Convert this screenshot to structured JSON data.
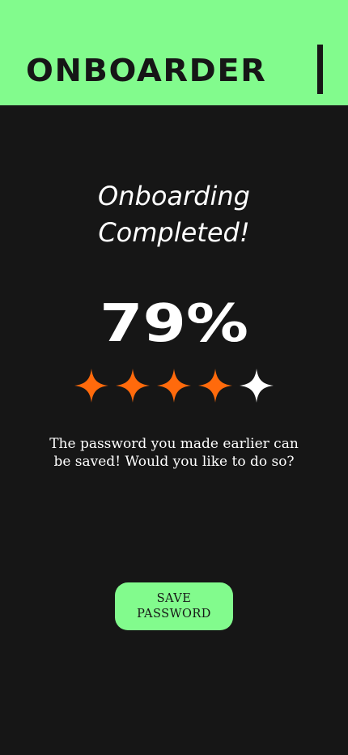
{
  "header": {
    "brand": "ONBOARDER"
  },
  "main": {
    "title_line1": "Onboarding",
    "title_line2": "Completed!",
    "percent": "79%",
    "rating": {
      "filled": 4,
      "total": 5,
      "filled_color": "#ff6a0c",
      "empty_color": "#ffffff"
    },
    "message_line1": "The password you made earlier can",
    "message_line2": "be saved! Would you like to do so?"
  },
  "action": {
    "save_line1": "SAVE",
    "save_line2": "PASSWORD"
  },
  "colors": {
    "background": "#161616",
    "accent": "#82fb8d",
    "text": "#ffffff"
  }
}
